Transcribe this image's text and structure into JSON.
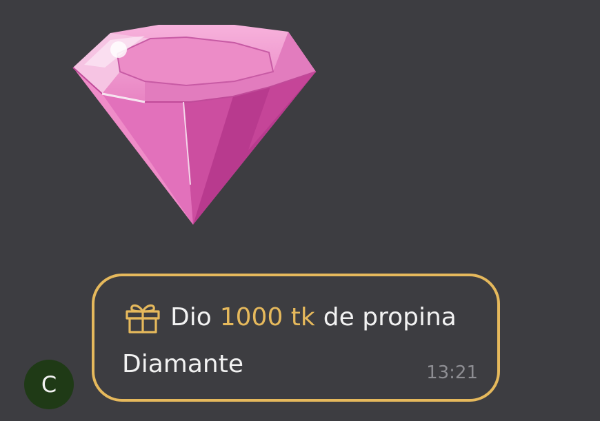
{
  "sticker": {
    "icon": "pink-diamond-sticker"
  },
  "sender": {
    "avatar_letter": "C"
  },
  "tip_message": {
    "icon": "gift-icon",
    "prefix": "Dio",
    "amount": "1000 tk",
    "suffix": "de propina",
    "gift_name": "Diamante",
    "time": "13:21"
  },
  "colors": {
    "background": "#3d3d41",
    "accent_gold": "#e6b95c",
    "text": "#f2f2f2",
    "timestamp": "#8e8e93",
    "avatar_bg": "#1f3a16",
    "diamond_pink": "#e070b8"
  }
}
